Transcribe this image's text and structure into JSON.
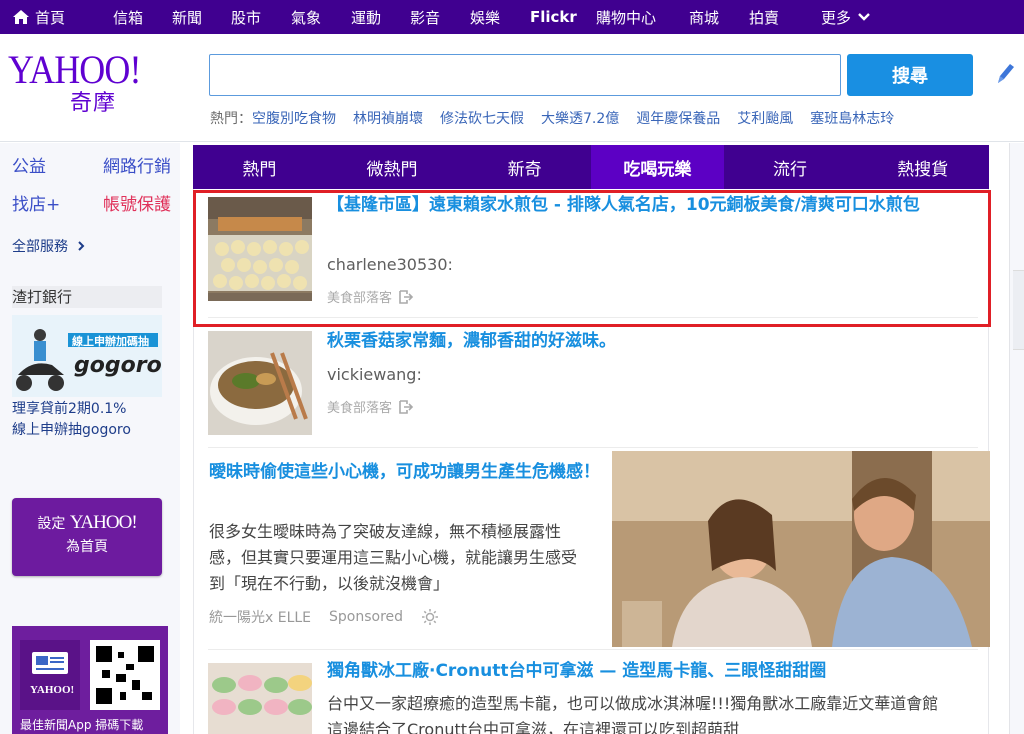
{
  "topnav": {
    "items": [
      "首頁",
      "信箱",
      "新聞",
      "股市",
      "氣象",
      "運動",
      "影音",
      "娛樂",
      "Flickr",
      "購物中心",
      "商城",
      "拍賣",
      "更多"
    ]
  },
  "header": {
    "logo_main": "YAHOO!",
    "logo_sub": "奇摩",
    "search_value": "",
    "search_button": "搜尋",
    "trending_label": "熱門：",
    "trending": [
      "空腹別吃食物",
      "林明禎崩壞",
      "修法砍七天假",
      "大樂透7.2億",
      "週年慶保養品",
      "艾利颱風",
      "塞班島林志玲"
    ]
  },
  "sidebar": {
    "links": [
      {
        "label": "公益"
      },
      {
        "label": "網路行銷"
      },
      {
        "label": "找店+"
      },
      {
        "label": "帳號保護"
      }
    ],
    "all_services": "全部服務",
    "section_title": "渣打銀行",
    "gogoro_text": "線上申辦加碼抽",
    "gogoro_brand": "gogoro",
    "bank_line1": "理享貸前2期0.1%",
    "bank_line2": "線上申辦抽gogoro",
    "set_home_prefix": "設定",
    "set_home_brand": "YAHOO!",
    "set_home_suffix": "為首頁",
    "app_ad_label": "最佳新聞App 掃碼下載",
    "app_ad_brand": "YAHOO!"
  },
  "tabs": [
    {
      "label": "熱門"
    },
    {
      "label": "微熱門"
    },
    {
      "label": "新奇"
    },
    {
      "label": "吃喝玩樂",
      "active": true
    },
    {
      "label": "流行"
    },
    {
      "label": "熱搜貨"
    }
  ],
  "feed": {
    "items": [
      {
        "title": "【基隆市區】遠東賴家水煎包 - 排隊人氣名店，10元銅板美食/清爽可口水煎包",
        "author": "charlene30530:",
        "source": "美食部落客"
      },
      {
        "title": "秋栗香菇家常麵，濃郁香甜的好滋味。",
        "author": "vickiewang:",
        "source": "美食部落客"
      }
    ],
    "ad": {
      "title": "曖昧時偷使這些小心機，可成功讓男生產生危機感！",
      "body": "很多女生曖昧時為了突破友達線，無不積極展露性感，但其實只要運用這三點小心機，就能讓男生感受到「現在不行動，以後就沒機會」",
      "advertiser": "統一陽光x ELLE",
      "sponsored": "Sponsored"
    },
    "item3": {
      "title": "獨角獸冰工廠·Cronutt台中可拿滋 — 造型馬卡龍、三眼怪甜甜圈",
      "body": "台中又一家超療癒的造型馬卡龍，也可以做成冰淇淋喔!!!獨角獸冰工廠靠近文華道會館這邊結合了Cronutt台中可拿滋，在這裡還可以吃到超萌甜"
    }
  }
}
